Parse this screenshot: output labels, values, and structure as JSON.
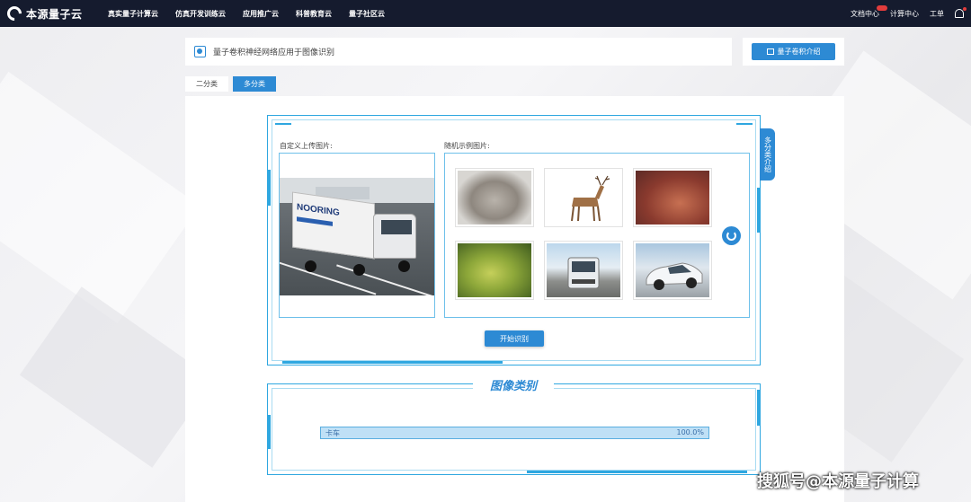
{
  "brand": {
    "name": "本源量子云"
  },
  "nav": {
    "items": [
      "真实量子计算云",
      "仿真开发训练云",
      "应用推广云",
      "科普教育云",
      "量子社区云"
    ],
    "right": {
      "docs": "文档中心",
      "compute": "计算中心",
      "ticket": "工单"
    }
  },
  "header": {
    "title": "量子卷积神经网络应用于图像识别",
    "intro_button": "量子卷积介绍"
  },
  "tabs": [
    {
      "label": "二分类",
      "active": false
    },
    {
      "label": "多分类",
      "active": true
    }
  ],
  "panel": {
    "side_tab": "多分类介绍",
    "upload_label": "自定义上传图片:",
    "random_label": "随机示例图片:",
    "uploaded_image": {
      "logo_text": "NOORING"
    },
    "thumbnails": [
      "cat",
      "deer",
      "deer",
      "frog",
      "truck",
      "car"
    ],
    "start_button": "开始识别"
  },
  "result": {
    "title": "图像类别",
    "rows": [
      {
        "label": "卡车",
        "value": "100.0%",
        "fraction": 1.0
      }
    ]
  },
  "watermark": "搜狐号@本源量子计算",
  "colors": {
    "accent": "#2d8ad4",
    "frame": "#2fa7e0",
    "topbar": "#151b2e"
  }
}
